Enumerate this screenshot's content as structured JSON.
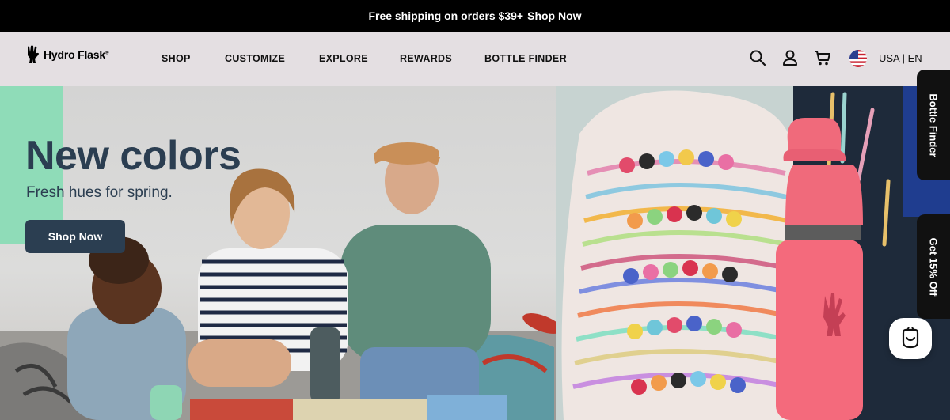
{
  "promo": {
    "text": "Free shipping on orders $39+",
    "link": "Shop Now"
  },
  "header": {
    "logo": "Hydro Flask",
    "logo_mark": "®",
    "nav": [
      "SHOP",
      "CUSTOMIZE",
      "EXPLORE",
      "REWARDS",
      "BOTTLE FINDER"
    ],
    "locale": "USA | EN"
  },
  "icons": {
    "search": "search-icon",
    "account": "account-icon",
    "cart": "cart-icon",
    "flag": "us-flag-icon",
    "chat": "chat-icon"
  },
  "hero": {
    "title": "New colors",
    "subtitle": "Fresh hues for spring.",
    "cta": "Shop Now"
  },
  "side_tabs": {
    "bottle_finder": "Bottle Finder",
    "discount": "Get 15% Off"
  },
  "colors": {
    "navy": "#2b3e51",
    "mint": "#8fdcb8",
    "header_bg": "#e4dfe2",
    "promo_bg": "#000000",
    "bottle_pink": "#f06a7b"
  }
}
